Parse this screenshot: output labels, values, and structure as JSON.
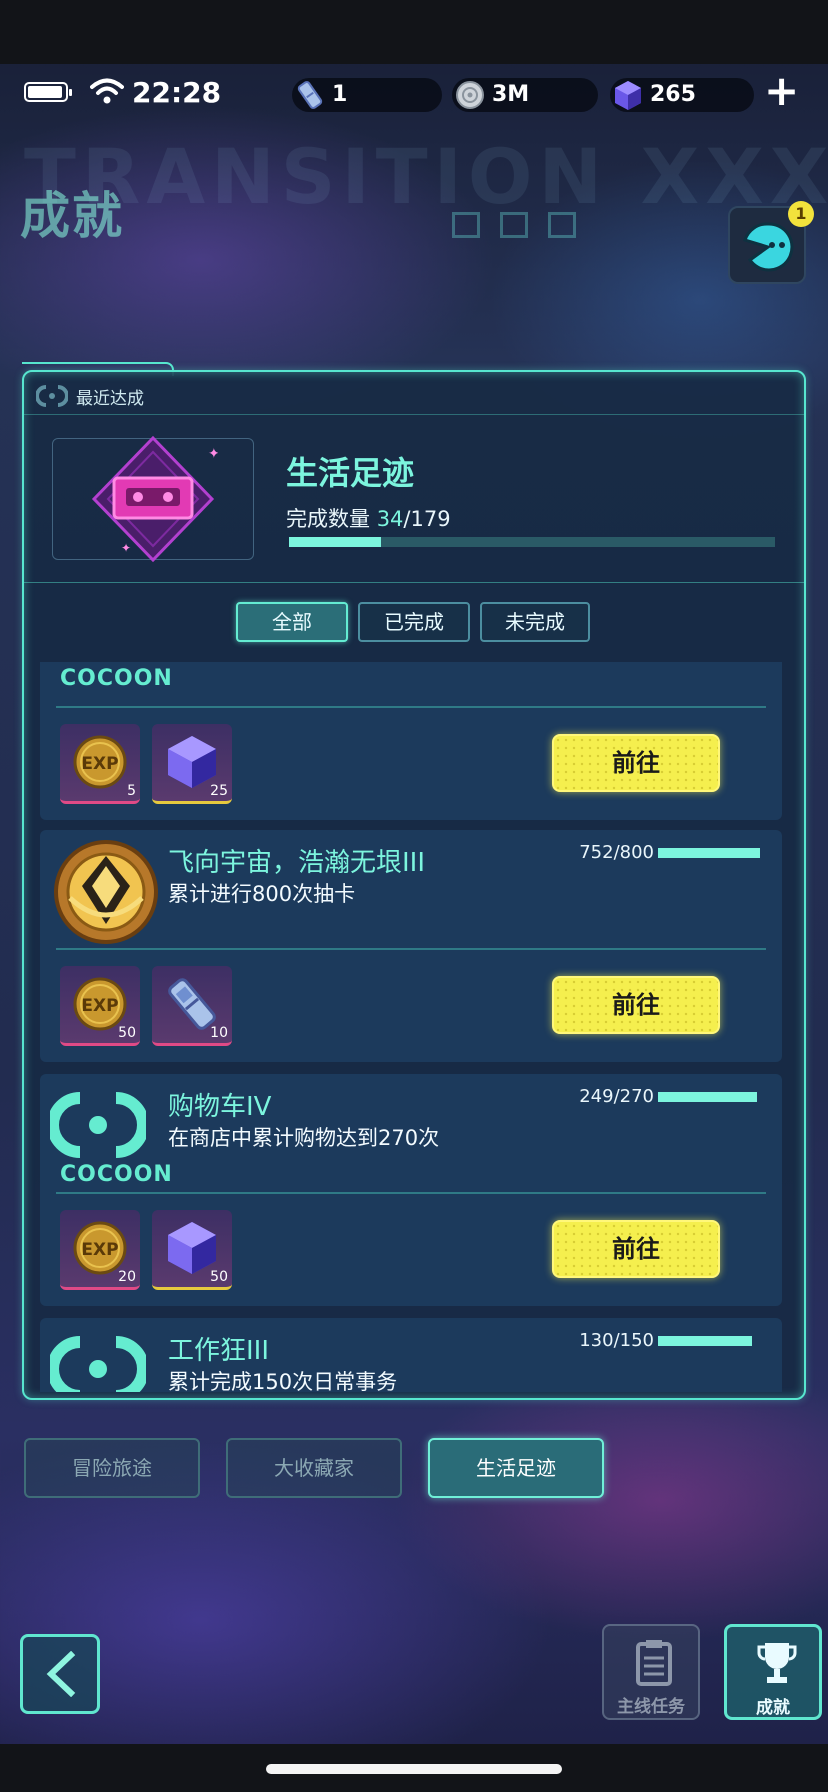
{
  "status_bar": {
    "time": "22:28"
  },
  "resources": [
    {
      "icon": "ticket-icon",
      "value": "1"
    },
    {
      "icon": "disc-coin-icon",
      "value": "3M"
    },
    {
      "icon": "gem-cube-icon",
      "value": "265"
    }
  ],
  "header": {
    "title": "成就",
    "background_text": "TRANSITION XXX",
    "notification_count": "1"
  },
  "recent": {
    "label": "最近达成",
    "title": "生活足迹",
    "progress_label": "完成数量",
    "progress_current": "34",
    "progress_total": "/179",
    "progress_fraction": 0.19
  },
  "filters": [
    "全部",
    "已完成",
    "未完成"
  ],
  "achievements": [
    {
      "title": "",
      "desc": "",
      "count": "",
      "progress": 0,
      "icon": "cocoon-logo",
      "rewards": [
        {
          "type": "exp",
          "qty": "5"
        },
        {
          "type": "gem",
          "qty": "25"
        }
      ],
      "button": "前往"
    },
    {
      "title": "飞向宇宙，浩瀚无垠III",
      "desc": "累计进行800次抽卡",
      "count": "752/800",
      "progress": 0.94,
      "icon": "golden-medal",
      "rewards": [
        {
          "type": "exp",
          "qty": "50"
        },
        {
          "type": "ticket",
          "qty": "10"
        }
      ],
      "button": "前往"
    },
    {
      "title": "购物车IV",
      "desc": "在商店中累计购物达到270次",
      "count": "249/270",
      "progress": 0.92,
      "icon": "cocoon-logo",
      "rewards": [
        {
          "type": "exp",
          "qty": "20"
        },
        {
          "type": "gem",
          "qty": "50"
        }
      ],
      "button": "前往"
    },
    {
      "title": "工作狂III",
      "desc": "累计完成150次日常事务",
      "count": "130/150",
      "progress": 0.87,
      "icon": "cocoon-logo",
      "rewards": [],
      "button": ""
    }
  ],
  "cocoon_text": "COCOON",
  "categories": [
    {
      "label": "冒险旅途",
      "active": false
    },
    {
      "label": "大收藏家",
      "active": false
    },
    {
      "label": "生活足迹",
      "active": true
    }
  ],
  "bottom_nav": {
    "main_tasks": "主线任务",
    "achievements": "成就"
  },
  "colors": {
    "accent": "#57e6cf",
    "button_yellow": "#f5ef4e",
    "text_highlight": "#7cf5de"
  }
}
